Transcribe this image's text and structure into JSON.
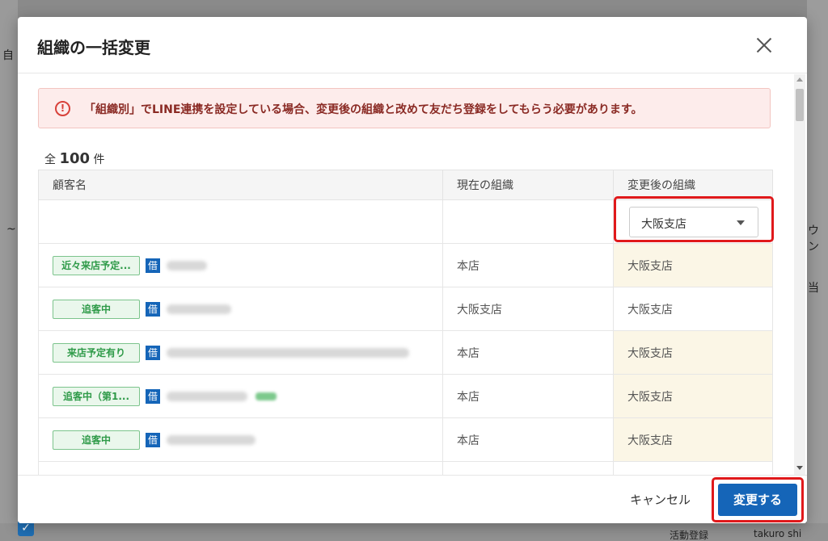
{
  "background": {
    "left_char": "自",
    "left_mark": "~",
    "right_chars": [
      "ウン",
      "当"
    ],
    "bottom_text": "活動登録",
    "bottom_user": "takuro shi"
  },
  "modal": {
    "title": "組織の一括変更",
    "close_label": "×",
    "alert": {
      "icon": "!",
      "text": "「組織別」でLINE連携を設定している場合、変更後の組織と改めて友だち登録をしてもらう必要があります。"
    },
    "count": {
      "prefix": "全",
      "number": "100",
      "suffix": "件"
    },
    "table": {
      "headers": [
        "顧客名",
        "現在の組織",
        "変更後の組織"
      ],
      "bulk_select": {
        "value": "大阪支店"
      },
      "rows": [
        {
          "tag": "近々来店予定...",
          "badge": "借",
          "current": "本店",
          "new": "大阪支店",
          "changed": true
        },
        {
          "tag": "追客中",
          "badge": "借",
          "current": "大阪支店",
          "new": "大阪支店",
          "changed": false
        },
        {
          "tag": "来店予定有り",
          "badge": "借",
          "current": "本店",
          "new": "大阪支店",
          "changed": true
        },
        {
          "tag": "追客中（第1...",
          "badge": "借",
          "current": "本店",
          "new": "大阪支店",
          "changed": true
        },
        {
          "tag": "追客中",
          "badge": "借",
          "current": "本店",
          "new": "大阪支店",
          "changed": true
        }
      ]
    },
    "footer": {
      "cancel_label": "キャンセル",
      "submit_label": "変更する"
    }
  },
  "colors": {
    "primary": "#1565b8",
    "highlight": "#e0191b",
    "alert_bg": "#fdeceb",
    "changed_bg": "#fbf6e6",
    "tag_green": "#2e9a48"
  }
}
